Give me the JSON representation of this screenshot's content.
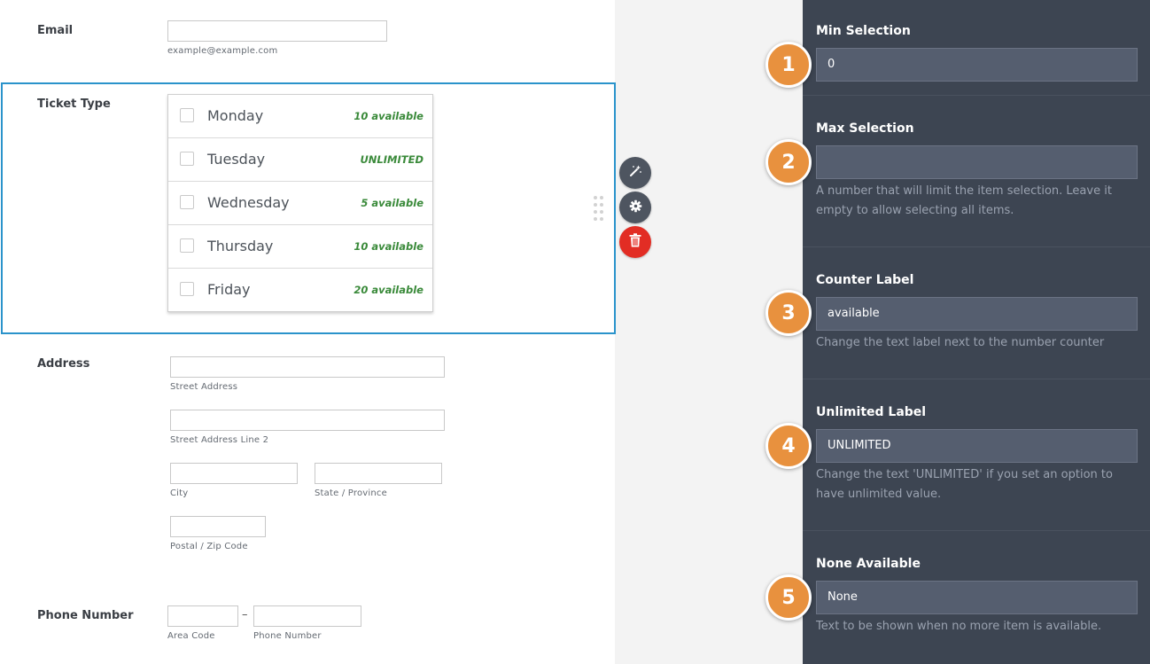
{
  "form": {
    "email": {
      "label": "Email",
      "value": "",
      "sublabel": "example@example.com"
    },
    "ticket": {
      "label": "Ticket Type",
      "options": [
        {
          "name": "Monday",
          "availability": "10 available",
          "checked": false
        },
        {
          "name": "Tuesday",
          "availability": "UNLIMITED",
          "checked": false
        },
        {
          "name": "Wednesday",
          "availability": "5 available",
          "checked": false
        },
        {
          "name": "Thursday",
          "availability": "10 available",
          "checked": false
        },
        {
          "name": "Friday",
          "availability": "20 available",
          "checked": false
        }
      ]
    },
    "address": {
      "label": "Address",
      "street_sublabel": "Street Address",
      "street2_sublabel": "Street Address Line 2",
      "city_sublabel": "City",
      "state_sublabel": "State / Province",
      "postal_sublabel": "Postal / Zip Code"
    },
    "phone": {
      "label": "Phone Number",
      "separator": "–",
      "area_sublabel": "Area Code",
      "number_sublabel": "Phone Number"
    }
  },
  "field_tools": {
    "wand_icon": "magic-wand-icon",
    "gear_icon": "gear-icon",
    "trash_icon": "trash-icon",
    "trash_color": "#e22d24"
  },
  "properties": {
    "min_selection": {
      "badge": "1",
      "title": "Min Selection",
      "value": "0"
    },
    "max_selection": {
      "badge": "2",
      "title": "Max Selection",
      "value": "",
      "help": "A number that will limit the item selection. Leave it empty to allow selecting all items."
    },
    "counter_label": {
      "badge": "3",
      "title": "Counter Label",
      "value": "available",
      "help": "Change the text label next to the number counter"
    },
    "unlimited_label": {
      "badge": "4",
      "title": "Unlimited Label",
      "value": "UNLIMITED",
      "help": "Change the text 'UNLIMITED' if you set an option to have unlimited value."
    },
    "none_available": {
      "badge": "5",
      "title": "None Available",
      "value": "None",
      "help": "Text to be shown when no more item is available."
    }
  },
  "colors": {
    "panel_bg": "#3d4552",
    "badge": "#e8913e",
    "selected_border": "#2a93cb",
    "available_text": "#3a8a3a"
  }
}
